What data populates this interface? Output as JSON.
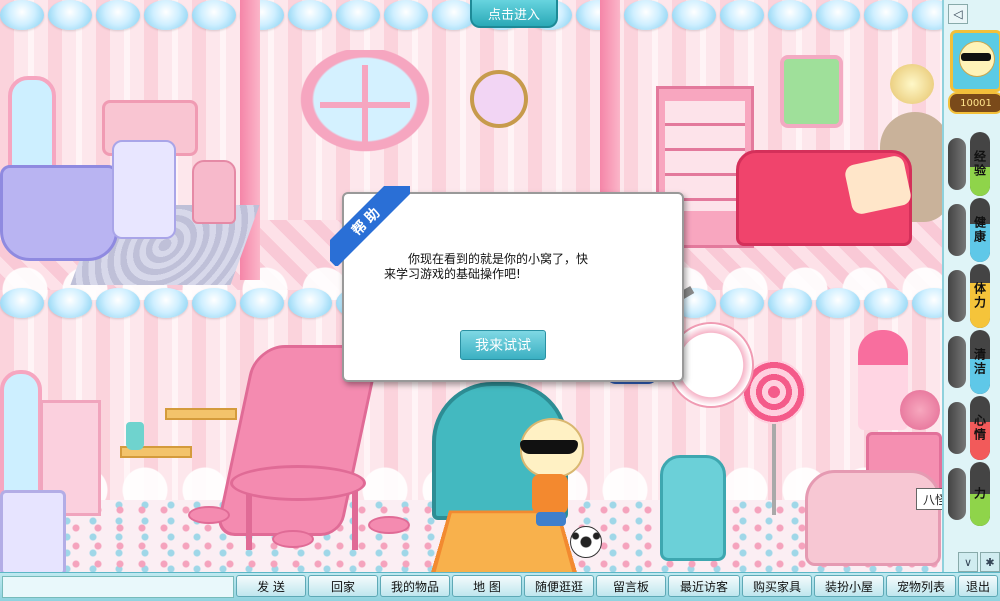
{
  "top": {
    "enter_label": "点击进入"
  },
  "dialog": {
    "ribbon": "帮助",
    "message": "你现在看到的就是你的小窝了，快来学习游戏的基础操作吧!",
    "button_label": "我来试试"
  },
  "room": {
    "owner_name_tag": "八怪怪才林仔"
  },
  "sidebar": {
    "collapse_icon": "collapse-icon",
    "coins": "10001",
    "stats": [
      {
        "label": "经验",
        "color": "#8fd44a",
        "level": 0.45
      },
      {
        "label": "健康",
        "color": "#5fc8e8",
        "level": 0.6
      },
      {
        "label": "体力",
        "color": "#f5c43a",
        "level": 0.7
      },
      {
        "label": "清洁",
        "color": "#5fc8e8",
        "level": 0.55
      },
      {
        "label": "心情",
        "color": "#f25a5a",
        "level": 0.6
      },
      {
        "label": "力",
        "color": "#8fd44a",
        "level": 0.5
      }
    ]
  },
  "menu": {
    "send": "发 送",
    "home": "回家",
    "items": "我的物品",
    "map": "地 图",
    "wander": "随便逛逛",
    "message_board": "留言板",
    "visitors": "最近访客",
    "buy_furniture": "购买家具",
    "decorate": "装扮小屋",
    "pets": "宠物列表",
    "exit": "退出"
  },
  "colors": {
    "accent": "#3bb0c2",
    "ribbon": "#2a6fd6",
    "room_pink": "#fbd3dc"
  }
}
